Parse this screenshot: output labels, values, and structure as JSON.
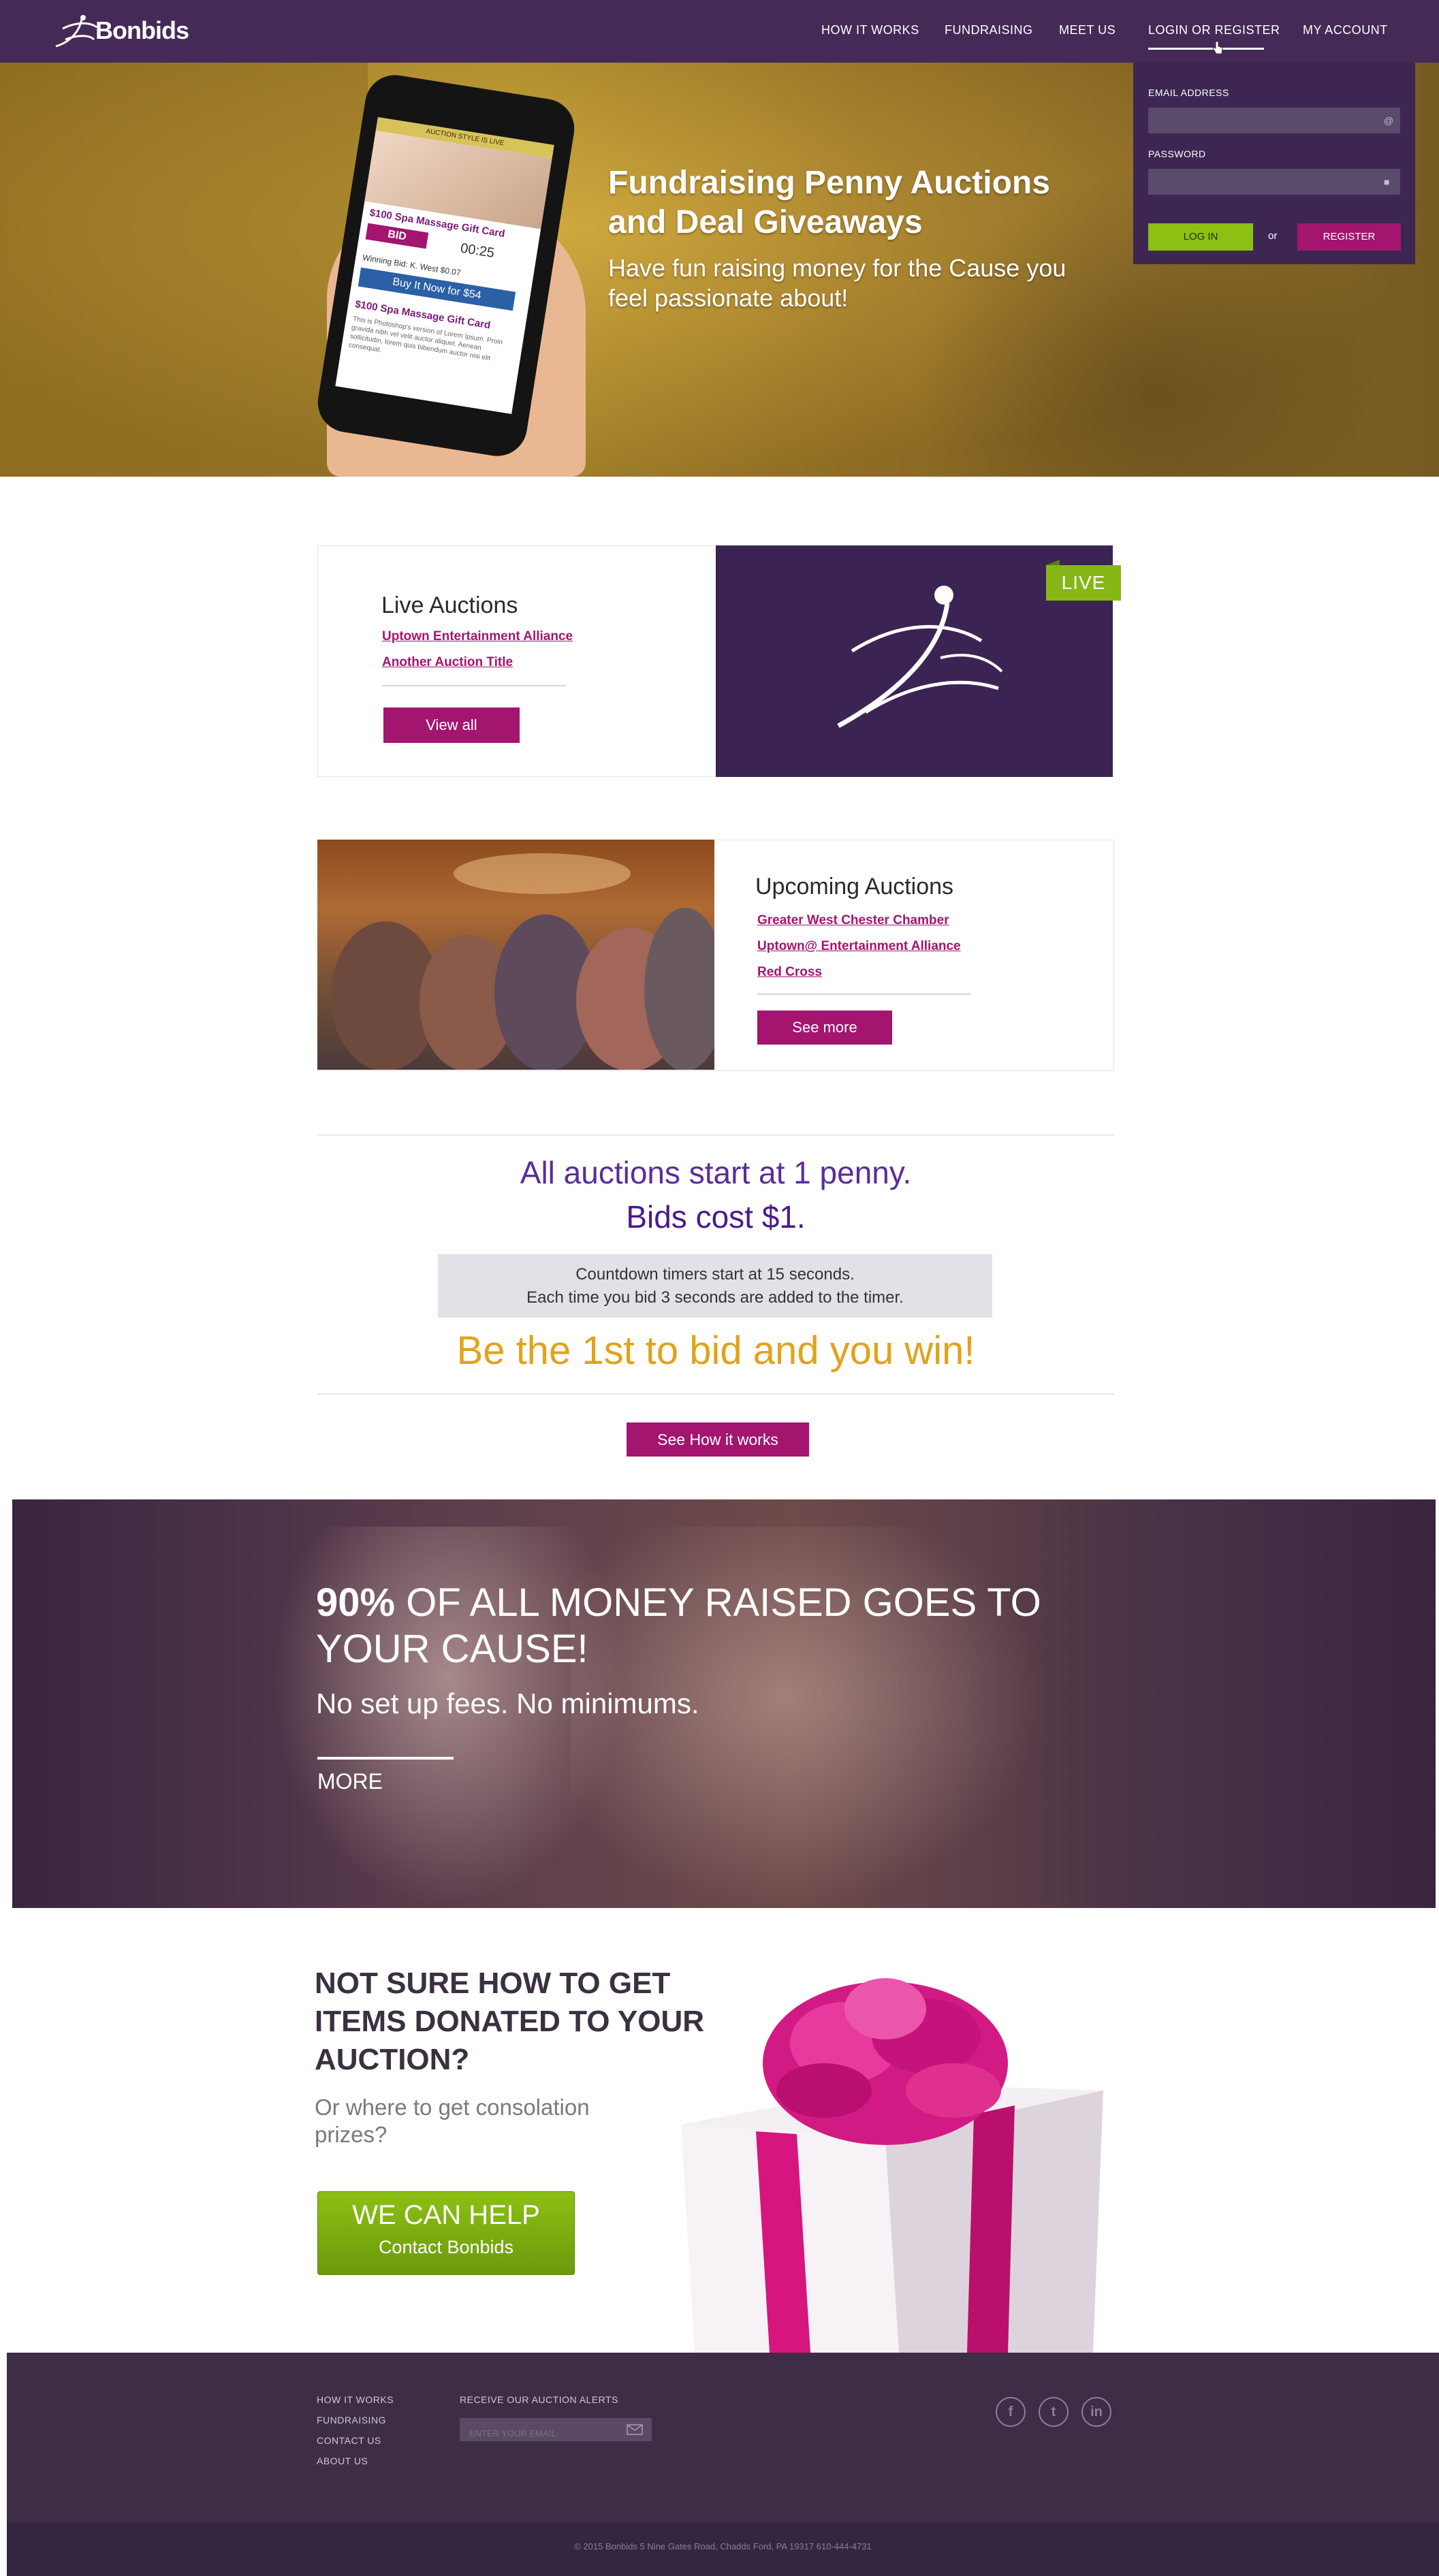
{
  "header": {
    "logo_text": "Bonbids",
    "nav": [
      "HOW IT WORKS",
      "FUNDRAISING",
      "MEET US",
      "LOGIN OR REGISTER",
      "MY ACCOUNT"
    ]
  },
  "hero": {
    "title": "Fundraising Penny Auctions and Deal Giveaways",
    "subtitle": "Have fun raising money for the Cause you feel passionate about!",
    "phone": {
      "band": "AUCTION STYLE IS LIVE",
      "item_title": "$100 Spa Massage Gift Card",
      "bid": "BID",
      "timer": "00:25",
      "winner": "Winning Bid: K. West $0.07",
      "buy_now": "Buy It Now for $54",
      "item_title_2": "$100 Spa Massage Gift Card",
      "desc": "This is Photoshop's version of Lorem Ipsum. Proin gravida nibh vel velit auctor aliquet. Aenean sollicitudin, lorem quis bibendum auctor nisi elit consequat."
    }
  },
  "login": {
    "email_label": "EMAIL ADDRESS",
    "password_label": "PASSWORD",
    "login_button": "LOG IN",
    "or": "or",
    "register_button": "REGISTER"
  },
  "live": {
    "title": "Live Auctions",
    "links": [
      "Uptown Entertainment Alliance",
      "Another Auction Title"
    ],
    "button": "View all",
    "badge": "LIVE"
  },
  "upcoming": {
    "title": "Upcoming Auctions",
    "links": [
      "Greater West Chester Chamber",
      "Uptown@ Entertainment Alliance",
      "Red Cross"
    ],
    "button": "See more"
  },
  "info": {
    "line1": "All auctions start at 1 penny.",
    "line2": "Bids cost $1.",
    "box_line1": "Countdown timers start at 15 seconds.",
    "box_line2": "Each time you bid 3 seconds are added to the timer.",
    "gold": "Be the 1st to bid and you win!",
    "button": "See How it works"
  },
  "band": {
    "percent": "90%",
    "headline": " OF ALL MONEY RAISED GOES TO YOUR CAUSE!",
    "sub": "No set up fees. No minimums.",
    "more": "MORE"
  },
  "donate": {
    "headline": "NOT SURE HOW TO GET ITEMS DONATED TO YOUR AUCTION?",
    "sub": "Or where to get consolation prizes?",
    "button_main": "WE CAN HELP",
    "button_sub": "Contact Bonbids"
  },
  "footer": {
    "links": [
      "HOW IT WORKS",
      "FUNDRAISING",
      "CONTACT US",
      "ABOUT US"
    ],
    "alerts_label": "RECEIVE OUR AUCTION ALERTS",
    "email_placeholder": "ENTER YOUR EMAIL",
    "social": [
      "facebook-icon",
      "twitter-icon",
      "linkedin-icon"
    ],
    "copyright": "© 2015 Bonbids 5 Nine Gates Road, Chadds Ford, PA 19317 610-444-4731"
  },
  "colors": {
    "brand_purple": "#452a57",
    "accent_magenta": "#a3156f",
    "accent_green": "#8cc012",
    "gold": "#e2a21a"
  }
}
